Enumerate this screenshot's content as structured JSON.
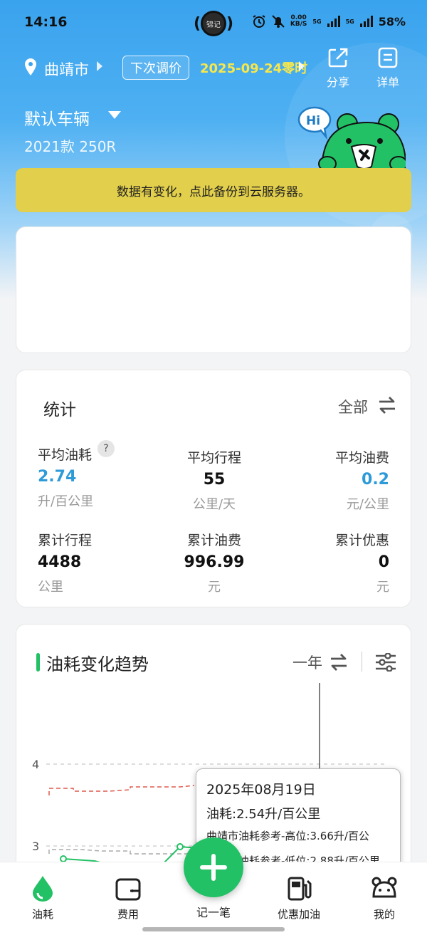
{
  "status_bar": {
    "time": "14:16",
    "center_badge": "锦记",
    "net_speed": "0.00",
    "net_unit": "KB/S",
    "signal1": "5G",
    "signal2": "5G",
    "battery": "58%"
  },
  "header": {
    "city": "曲靖市",
    "price_label": "下次调价",
    "price_date": "2025-09-24零时",
    "share_label": "分享",
    "detail_label": "详单"
  },
  "vehicle": {
    "name": "默认车辆",
    "model": "2021款 250R"
  },
  "mascot": {
    "bubble_text": "Hi"
  },
  "backup_banner": "数据有变化，点此备份到云服务器。",
  "stats": {
    "title": "统计",
    "filter": "全部",
    "items": [
      {
        "label": "平均油耗",
        "value": "2.74",
        "unit": "升/百公里",
        "help": "?"
      },
      {
        "label": "平均行程",
        "value": "55",
        "unit": "公里/天"
      },
      {
        "label": "平均油费",
        "value": "0.2",
        "unit": "元/公里"
      },
      {
        "label": "累计行程",
        "value": "4488",
        "unit": "公里"
      },
      {
        "label": "累计油费",
        "value": "996.99",
        "unit": "元"
      },
      {
        "label": "累计优惠",
        "value": "0",
        "unit": "元"
      }
    ]
  },
  "trend": {
    "title": "油耗变化趋势",
    "period": "一年",
    "y_ticks": [
      "4",
      "3"
    ],
    "tooltip": {
      "date": "2025年08月19日",
      "line1": "油耗:2.54升/百公里",
      "line2": "曲靖市油耗参考-高位:3.66升/百公",
      "line3": "曲靖市油耗参考-低位:2.88升/百公里"
    }
  },
  "colors": {
    "accent_green": "#23c165",
    "header_blue": "#3aa3ee",
    "banner_yellow": "#e2cf4b",
    "value_blue": "#2e9bd8",
    "ref_high": "#e05a4f"
  },
  "bottom_nav": {
    "items": [
      {
        "label": "油耗",
        "icon": "fuel-drop-icon"
      },
      {
        "label": "费用",
        "icon": "wallet-icon"
      },
      {
        "label": "记一笔",
        "icon": "plus-icon"
      },
      {
        "label": "优惠加油",
        "icon": "gas-pump-icon"
      },
      {
        "label": "我的",
        "icon": "bear-face-icon"
      }
    ]
  }
}
